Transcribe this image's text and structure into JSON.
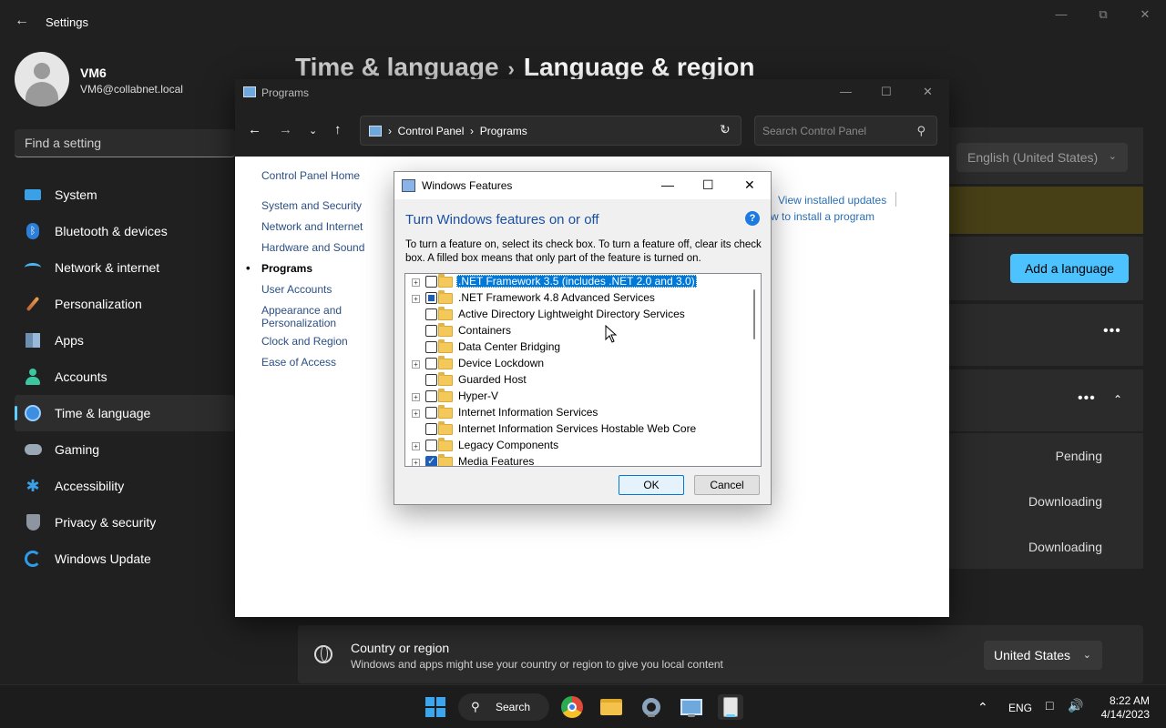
{
  "settings": {
    "title": "Settings",
    "profile": {
      "name": "VM6",
      "email": "VM6@collabnet.local"
    },
    "search_placeholder": "Find a setting",
    "nav": [
      {
        "label": "System",
        "icon": "system-icon"
      },
      {
        "label": "Bluetooth & devices",
        "icon": "bluetooth-icon"
      },
      {
        "label": "Network & internet",
        "icon": "wifi-icon"
      },
      {
        "label": "Personalization",
        "icon": "brush-icon"
      },
      {
        "label": "Apps",
        "icon": "apps-icon"
      },
      {
        "label": "Accounts",
        "icon": "person-icon"
      },
      {
        "label": "Time & language",
        "icon": "clock-globe-icon",
        "active": true
      },
      {
        "label": "Gaming",
        "icon": "gamepad-icon"
      },
      {
        "label": "Accessibility",
        "icon": "accessibility-icon"
      },
      {
        "label": "Privacy & security",
        "icon": "shield-icon"
      },
      {
        "label": "Windows Update",
        "icon": "update-icon"
      }
    ],
    "breadcrumb": {
      "parent": "Time & language",
      "current": "Language & region"
    },
    "display_language_value": "English (United States)",
    "add_language_label": "Add a language",
    "statuses": [
      "Pending",
      "Downloading",
      "Downloading"
    ],
    "country": {
      "title": "Country or region",
      "description": "Windows and apps might use your country or region to give you local content",
      "value": "United States"
    },
    "accent_color": "#4cc2ff"
  },
  "control_panel": {
    "window_title": "Programs",
    "address": [
      "Control Panel",
      "Programs"
    ],
    "search_placeholder": "Search Control Panel",
    "sidebar": {
      "home": "Control Panel Home",
      "items": [
        "System and Security",
        "Network and Internet",
        "Hardware and Sound",
        "Programs",
        "User Accounts",
        "Appearance and Personalization",
        "Clock and Region",
        "Ease of Access"
      ],
      "current": "Programs"
    },
    "link_view_updates": "View installed updates",
    "link_install_program": "w to install a program"
  },
  "windows_features": {
    "title": "Windows Features",
    "heading": "Turn Windows features on or off",
    "description": "To turn a feature on, select its check box. To turn a feature off, clear its check box. A filled box means that only part of the feature is turned on.",
    "features": [
      {
        "label": ".NET Framework 3.5 (includes .NET 2.0 and 3.0)",
        "expandable": true,
        "state": "unchecked",
        "selected": true
      },
      {
        "label": ".NET Framework 4.8 Advanced Services",
        "expandable": true,
        "state": "partial"
      },
      {
        "label": "Active Directory Lightweight Directory Services",
        "expandable": false,
        "state": "unchecked"
      },
      {
        "label": "Containers",
        "expandable": false,
        "state": "unchecked"
      },
      {
        "label": "Data Center Bridging",
        "expandable": false,
        "state": "unchecked"
      },
      {
        "label": "Device Lockdown",
        "expandable": true,
        "state": "unchecked"
      },
      {
        "label": "Guarded Host",
        "expandable": false,
        "state": "unchecked"
      },
      {
        "label": "Hyper-V",
        "expandable": true,
        "state": "unchecked"
      },
      {
        "label": "Internet Information Services",
        "expandable": true,
        "state": "unchecked"
      },
      {
        "label": "Internet Information Services Hostable Web Core",
        "expandable": false,
        "state": "unchecked"
      },
      {
        "label": "Legacy Components",
        "expandable": true,
        "state": "unchecked"
      },
      {
        "label": "Media Features",
        "expandable": true,
        "state": "checked"
      }
    ],
    "ok_label": "OK",
    "cancel_label": "Cancel"
  },
  "taskbar": {
    "search_label": "Search",
    "apps": [
      "start-icon",
      "chrome-icon",
      "file-explorer-icon",
      "settings-icon",
      "control-panel-icon",
      "windows-features-icon"
    ],
    "language": "ENG",
    "time": "8:22 AM",
    "date": "4/14/2023"
  }
}
